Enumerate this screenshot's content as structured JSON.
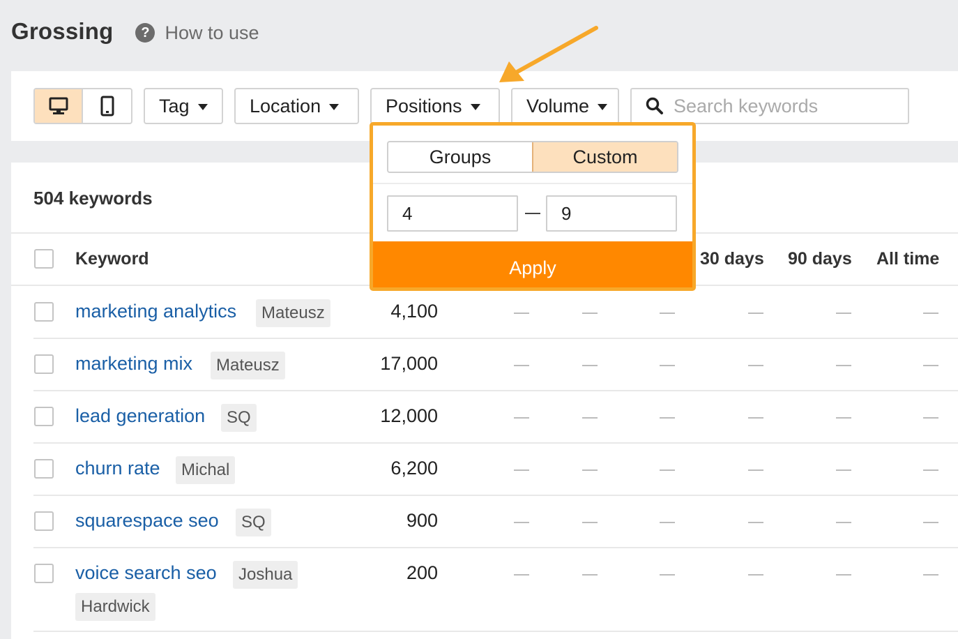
{
  "header": {
    "title": "Grossing",
    "help_icon": "question-circle-icon",
    "how_to_use": "How to use"
  },
  "toolbar": {
    "device_desktop_icon": "desktop-icon",
    "device_mobile_icon": "mobile-icon",
    "filters": {
      "tag": "Tag",
      "location": "Location",
      "positions": "Positions",
      "volume": "Volume"
    },
    "search": {
      "icon": "search-icon",
      "placeholder": "Search keywords",
      "value": ""
    }
  },
  "positions_dropdown": {
    "tabs": [
      "Groups",
      "Custom"
    ],
    "selected_tab": "Custom",
    "range_from": "4",
    "range_to": "9",
    "apply_label": "Apply"
  },
  "table": {
    "count_label": "504 keywords",
    "headers": {
      "keyword": "Keyword",
      "days30": "30 days",
      "days90": "90 days",
      "all_time": "All time"
    },
    "rows": [
      {
        "keyword": "marketing analytics",
        "tag": "Mateusz",
        "volume": "4,100",
        "cells": [
          "—",
          "—",
          "—",
          "—",
          "—",
          "—"
        ]
      },
      {
        "keyword": "marketing mix",
        "tag": "Mateusz",
        "volume": "17,000",
        "cells": [
          "—",
          "—",
          "—",
          "—",
          "—",
          "—"
        ]
      },
      {
        "keyword": "lead generation",
        "tag": "SQ",
        "volume": "12,000",
        "cells": [
          "—",
          "—",
          "—",
          "—",
          "—",
          "—"
        ]
      },
      {
        "keyword": "churn rate",
        "tag": "Michal",
        "volume": "6,200",
        "cells": [
          "—",
          "—",
          "—",
          "—",
          "—",
          "—"
        ]
      },
      {
        "keyword": "squarespace seo",
        "tag": "SQ",
        "volume": "900",
        "cells": [
          "—",
          "—",
          "—",
          "—",
          "—",
          "—"
        ]
      },
      {
        "keyword": "voice search seo",
        "tag": "Joshua Hardwick",
        "tag_line1": "Joshua",
        "tag_line2": "Hardwick",
        "volume": "200",
        "cells": [
          "—",
          "—",
          "—",
          "—",
          "—",
          "—"
        ]
      }
    ]
  },
  "colors": {
    "accent_orange": "#ff8800",
    "highlight_border": "#f7a82a",
    "active_fill": "#fde0bd",
    "link_blue": "#1a5fa6"
  }
}
